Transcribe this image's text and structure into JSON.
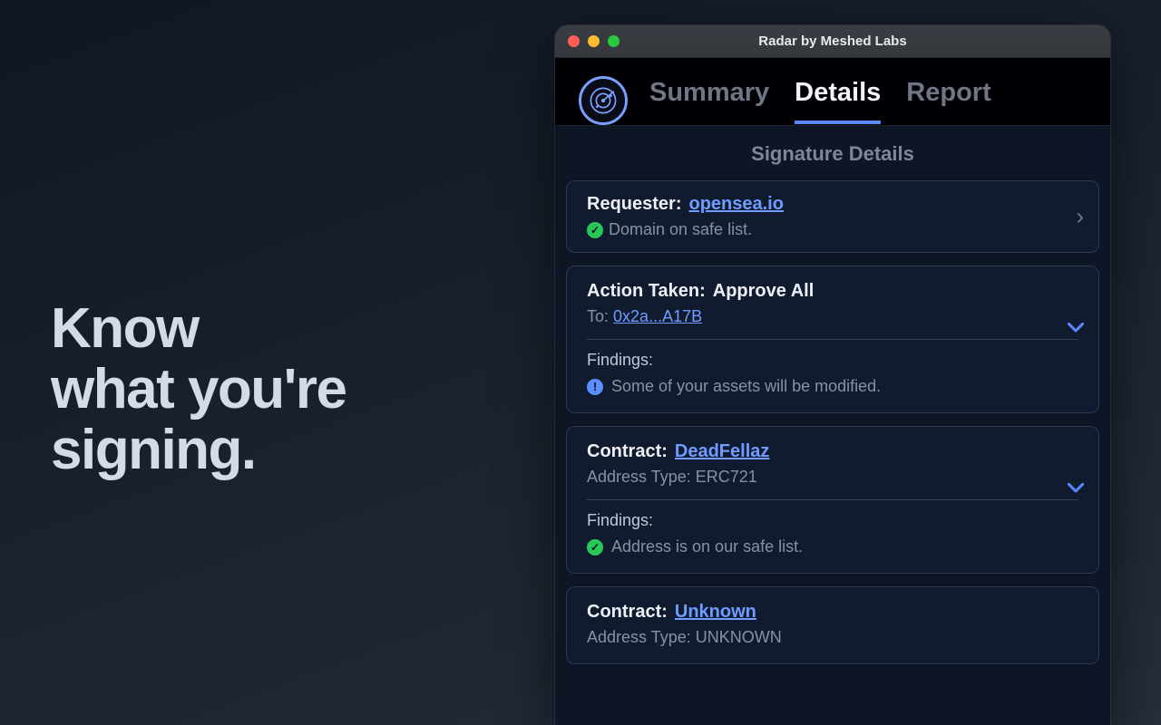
{
  "hero": {
    "line1": "Know",
    "line2": "what you're",
    "line3": "signing."
  },
  "window": {
    "title": "Radar by Meshed Labs"
  },
  "tabs": {
    "summary": "Summary",
    "details": "Details",
    "report": "Report",
    "active": "details"
  },
  "section_title": "Signature Details",
  "requester": {
    "label": "Requester:",
    "domain": "opensea.io",
    "status_text": "Domain on safe list."
  },
  "action": {
    "label": "Action Taken:",
    "value": "Approve All",
    "to_label": "To:",
    "to_value": "0x2a...A17B",
    "findings_label": "Findings:",
    "finding_text": "Some of your assets will be modified."
  },
  "contract1": {
    "label": "Contract:",
    "name": "DeadFellaz",
    "addr_type_label": "Address Type:",
    "addr_type_value": "ERC721",
    "findings_label": "Findings:",
    "finding_text": "Address is on our safe list."
  },
  "contract2": {
    "label": "Contract:",
    "name": "Unknown",
    "addr_type_label": "Address Type:",
    "addr_type_value": "UNKNOWN"
  }
}
